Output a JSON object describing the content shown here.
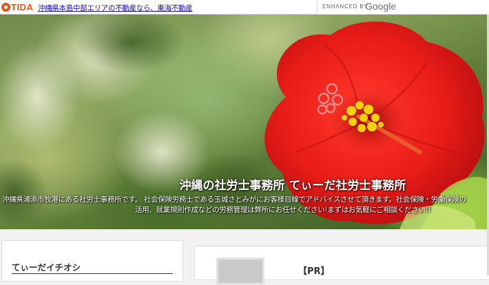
{
  "topbar": {
    "logo_text": "TIDA",
    "link_text": "沖縄県本島中部エリアの不動産なら、東海不動産",
    "search_label": "ENHANCED BY",
    "search_brand": "Google"
  },
  "hero": {
    "title": "沖縄の社労士事務所 てぃーだ社労士事務所",
    "description_line1": "沖縄県浦添市牧港にある社労士事務所です。 社会保険労務士である玉城さとみがにお客様目線でアドバイスさせて頂きます。社会保険・労働保険の",
    "description_line2": "活用、就業規則作成などの労務管理は弊所にお任せください!まずはお気軽にご相談ください!!"
  },
  "sidebar": {
    "heading": "てぃーだイチオシ"
  },
  "main": {
    "pr_label": "【PR】"
  },
  "colors": {
    "brand": "#e2561f",
    "link": "#1a0dab"
  }
}
